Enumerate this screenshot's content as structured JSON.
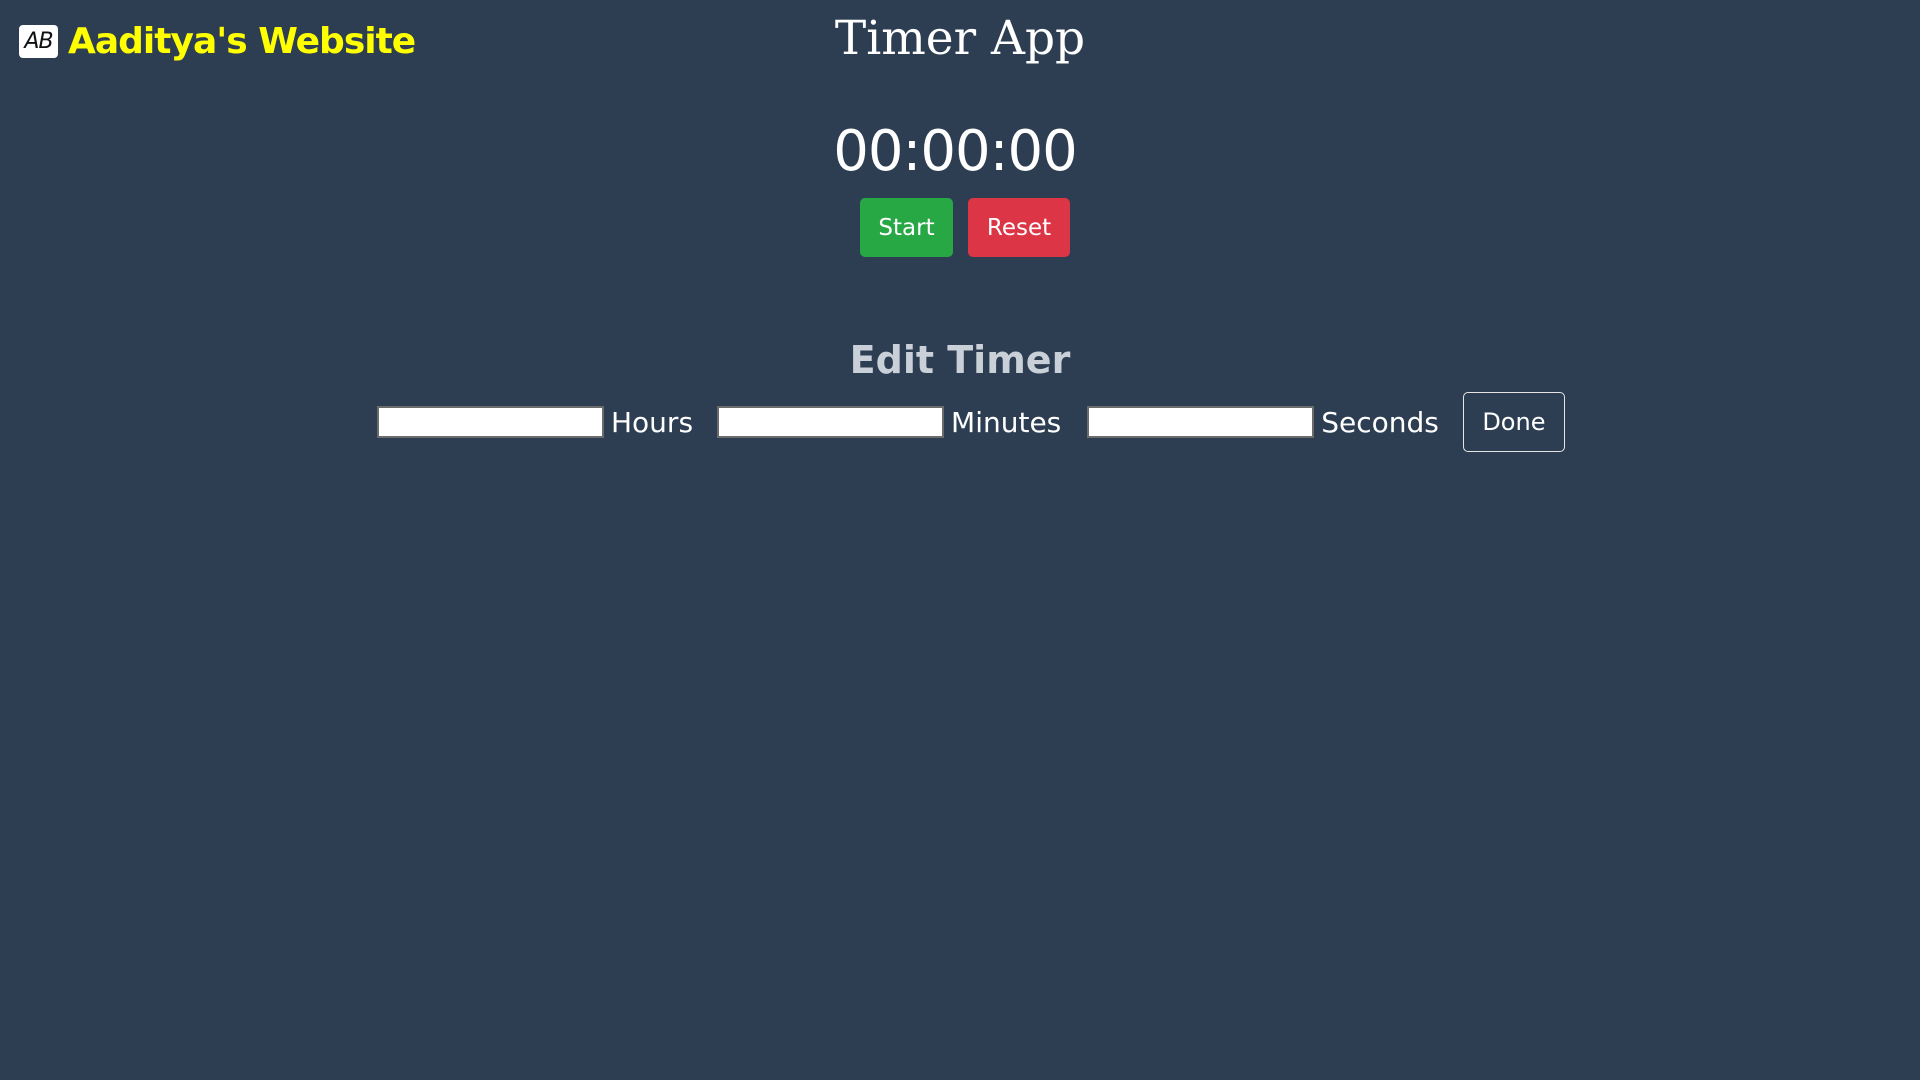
{
  "brand": {
    "logo_text": "AB",
    "name": "Aaditya's Website"
  },
  "app": {
    "title": "Timer App"
  },
  "timer": {
    "display": "00:00:00",
    "start_label": "Start",
    "reset_label": "Reset"
  },
  "edit": {
    "title": "Edit Timer",
    "hours_label": "Hours",
    "minutes_label": "Minutes",
    "seconds_label": "Seconds",
    "hours_value": "",
    "minutes_value": "",
    "seconds_value": "",
    "done_label": "Done"
  },
  "colors": {
    "background": "#2d3e53",
    "brand_text": "#ffff00",
    "start": "#28a745",
    "reset": "#dc3545"
  }
}
